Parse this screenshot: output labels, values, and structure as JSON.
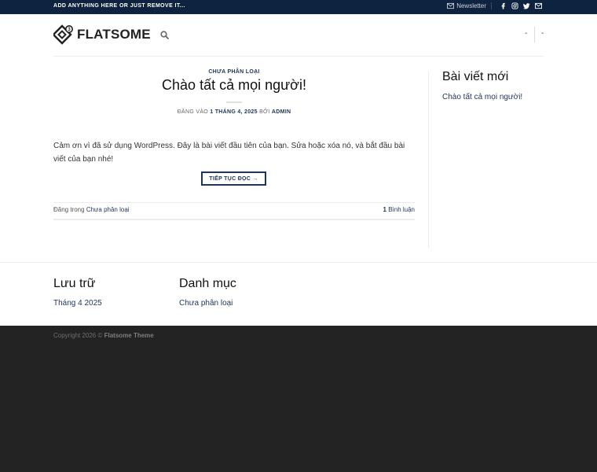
{
  "topbar": {
    "message": "ADD ANYTHING HERE OR JUST REMOVE IT...",
    "newsletter_label": "Newsletter",
    "social_icons": [
      "facebook-icon",
      "instagram-icon",
      "twitter-icon",
      "envelope-icon"
    ]
  },
  "header": {
    "logo_text": "FLATSOME",
    "menu_left_dash": "-",
    "menu_right_dash": "-"
  },
  "post": {
    "category": "CHƯA PHÂN LOẠI",
    "title": "Chào tất cả mọi người!",
    "meta_prefix": "ĐĂNG VÀO",
    "meta_date": "1 THÁNG 4, 2025",
    "meta_by": "BỞI",
    "meta_author": "ADMIN",
    "excerpt": "Cảm ơn vì đã sử dụng WordPress. Đây là bài viết đầu tiên của bạn. Sửa hoặc xóa nó, và bắt đầu bài viết của bạn nhé!",
    "read_more": "TIẾP TỤC ĐỌC →",
    "posted_in_label": "Đăng trong",
    "posted_in_category": "Chưa phân loại",
    "comments_count": "1",
    "comments_label": "Bình luận"
  },
  "sidebar": {
    "title": "Bài viết mới",
    "recent_post": "Chào tất cả mọi người!"
  },
  "widgets": {
    "archive_title": "Lưu trữ",
    "archive_link": "Tháng 4 2025",
    "category_title": "Danh mục",
    "category_link": "Chưa phân loại"
  },
  "footer": {
    "copyright_prefix": "Copyright 2026 ©",
    "copyright_brand": "Flatsome Theme"
  },
  "colors": {
    "topbar_bg": "#0d2340",
    "accent": "#1d3557",
    "footer_bg": "#232323"
  }
}
